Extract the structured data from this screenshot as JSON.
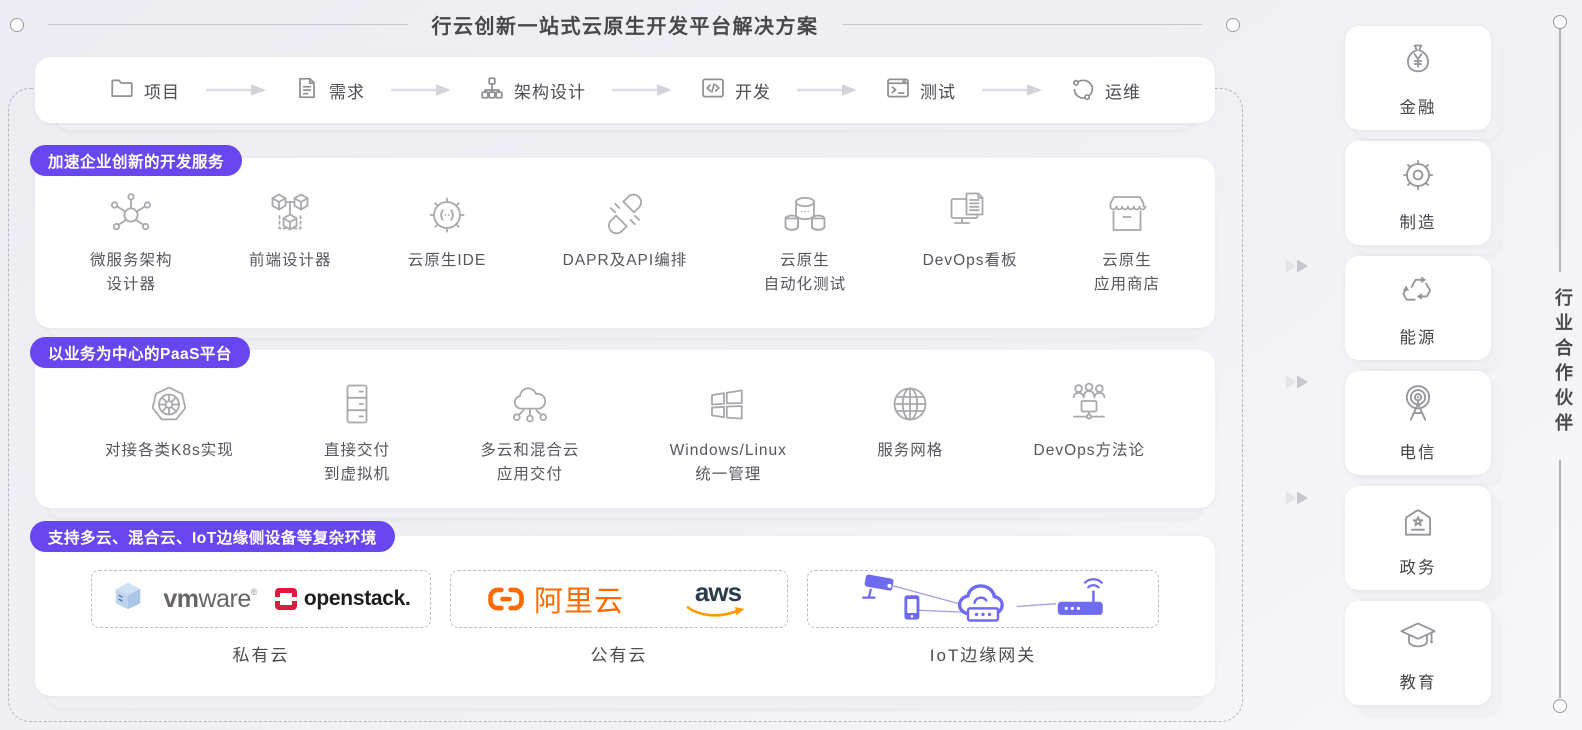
{
  "page": {
    "title": "行云创新一站式云原生开发平台解决方案"
  },
  "flow": {
    "items": [
      {
        "label": "项目",
        "icon": "folder-icon"
      },
      {
        "label": "需求",
        "icon": "document-icon"
      },
      {
        "label": "架构设计",
        "icon": "sitemap-icon"
      },
      {
        "label": "开发",
        "icon": "code-window-icon"
      },
      {
        "label": "测试",
        "icon": "terminal-icon"
      },
      {
        "label": "运维",
        "icon": "ops-cycle-icon"
      }
    ]
  },
  "sections": [
    {
      "badge": "加速企业创新的开发服务",
      "items": [
        {
          "line1": "微服务架构",
          "line2": "设计器",
          "icon": "microservice-icon"
        },
        {
          "line1": "前端设计器",
          "icon": "cubes-icon"
        },
        {
          "line1": "云原生IDE",
          "icon": "gear-code-icon"
        },
        {
          "line1": "DAPR及API编排",
          "icon": "plug-icon"
        },
        {
          "line1": "云原生",
          "line2": "自动化测试",
          "icon": "database-icon"
        },
        {
          "line1": "DevOps看板",
          "icon": "monitor-doc-icon"
        },
        {
          "line1": "云原生",
          "line2": "应用商店",
          "icon": "storefront-icon"
        }
      ]
    },
    {
      "badge": "以业务为中心的PaaS平台",
      "items": [
        {
          "line1": "对接各类K8s实现",
          "icon": "k8s-wheel-icon"
        },
        {
          "line1": "直接交付",
          "line2": "到虚拟机",
          "icon": "server-icon"
        },
        {
          "line1": "多云和混合云",
          "line2": "应用交付",
          "icon": "cloud-network-icon"
        },
        {
          "line1": "Windows/Linux",
          "line2": "统一管理",
          "icon": "windows-icon"
        },
        {
          "line1": "服务网格",
          "icon": "globe-icon"
        },
        {
          "line1": "DevOps方法论",
          "icon": "team-icon"
        }
      ]
    },
    {
      "badge": "支持多云、混合云、IoT边缘侧设备等复杂环境",
      "environments": [
        {
          "label": "私有云",
          "logos": [
            {
              "name": "vmware",
              "bold": "vm",
              "light": "ware",
              "reg": "®"
            },
            {
              "name": "openstack",
              "text": "openstack."
            }
          ]
        },
        {
          "label": "公有云",
          "logos": [
            {
              "name": "alibaba-cloud",
              "text": "阿里云"
            },
            {
              "name": "aws",
              "text": "aws"
            }
          ]
        },
        {
          "label": "IoT边缘网关",
          "logos": [
            {
              "name": "iot-devices"
            }
          ]
        }
      ]
    }
  ],
  "sidebar": {
    "title": "行业合作伙伴",
    "items": [
      {
        "label": "金融",
        "icon": "money-bag-icon"
      },
      {
        "label": "制造",
        "icon": "gear-icon"
      },
      {
        "label": "能源",
        "icon": "recycle-icon"
      },
      {
        "label": "电信",
        "icon": "antenna-icon"
      },
      {
        "label": "政务",
        "icon": "government-icon"
      },
      {
        "label": "教育",
        "icon": "graduation-cap-icon"
      }
    ]
  },
  "colors": {
    "badge_purple": "#6847f0",
    "iot_purple": "#6f6af2",
    "alibaba_orange": "#ff6a00",
    "aws_navy": "#2b3b4e",
    "aws_orange": "#ff9900",
    "openstack_red": "#e0193f",
    "vmware_gray": "#696566",
    "icon_gray": "#a8a8ad"
  }
}
